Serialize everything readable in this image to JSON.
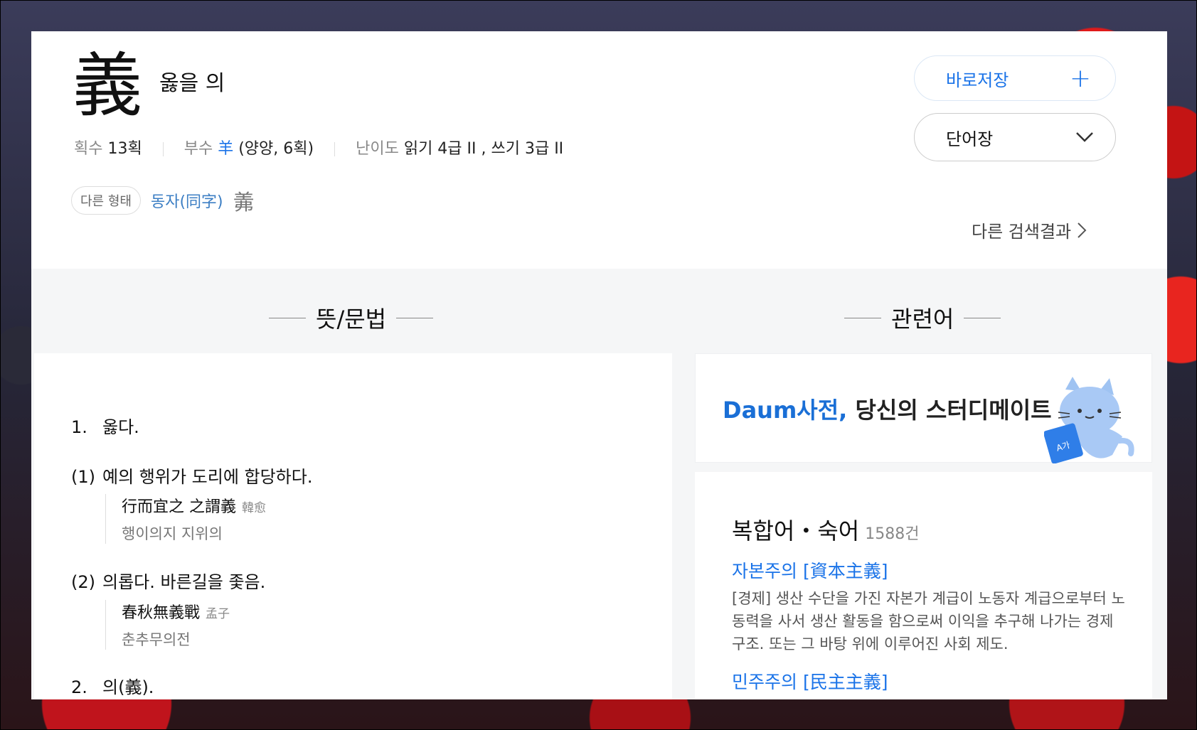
{
  "entry": {
    "hanja": "義",
    "reading": "옳을 의",
    "strokes_label": "획수",
    "strokes_value": "13획",
    "radical_label": "부수",
    "radical_char": "羊",
    "radical_detail": "(양양, 6획)",
    "level_label": "난이도",
    "level_value": "읽기 4급 II , 쓰기 3급 II"
  },
  "other_form": {
    "pill": "다른 형태",
    "link": "동자(同字)",
    "hanja": "羛"
  },
  "buttons": {
    "save": "바로저장",
    "save_icon": "+",
    "vocab": "단어장"
  },
  "more_results": "다른 검색결과",
  "sections": {
    "meaning": "뜻/문법",
    "related": "관련어"
  },
  "definitions": [
    {
      "num": "1.",
      "text": "옳다."
    },
    {
      "num": "(1)",
      "text": "예의 행위가 도리에 합당하다.",
      "example": "行而宜之 之謂義",
      "author": "韓愈",
      "translation": "행이의지 지위의"
    },
    {
      "num": "(2)",
      "text": "의롭다. 바른길을 좇음.",
      "example": "春秋無義戰",
      "author": "孟子",
      "translation": "춘추무의전"
    },
    {
      "num": "2.",
      "text": "의(義)."
    }
  ],
  "banner": {
    "brand": "Daum사전,",
    "tagline": " 당신의 스터디메이트"
  },
  "related": {
    "title": "복합어・숙어",
    "count": "1588건",
    "items": [
      {
        "word": "자본주의 [資本主義]",
        "desc": "[경제] 생산 수단을 가진 자본가 계급이 노동자 계급으로부터 노동력을 사서 생산 활동을 함으로써 이익을 추구해 나가는 경제 구조. 또는 그 바탕 위에 이루어진 사회 제도."
      },
      {
        "word": "민주주의 [民主主義]",
        "desc": ""
      }
    ]
  },
  "colors": {
    "accent": "#1a73e8",
    "link": "#3d7fc4"
  }
}
